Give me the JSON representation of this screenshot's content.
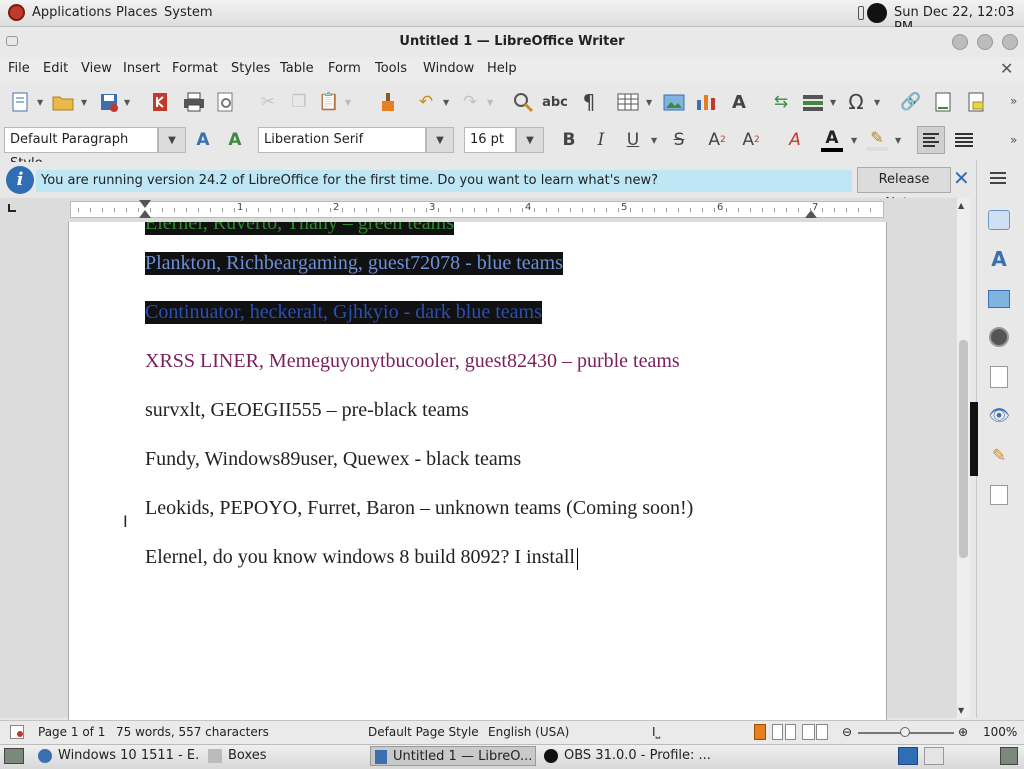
{
  "top_panel": {
    "applications": "Applications",
    "places": "Places",
    "system": "System",
    "clock": "Sun Dec 22, 12:03 PM"
  },
  "window": {
    "title": "Untitled 1 — LibreOffice Writer"
  },
  "menu": {
    "file": "File",
    "edit": "Edit",
    "view": "View",
    "insert": "Insert",
    "format": "Format",
    "styles": "Styles",
    "table": "Table",
    "form": "Form",
    "tools": "Tools",
    "window": "Window",
    "help": "Help"
  },
  "formatting": {
    "paragraph_style": "Default Paragraph Style",
    "font_name": "Liberation Serif",
    "font_size": "16 pt"
  },
  "infobar": {
    "message": "You are running version 24.2 of LibreOffice for the first time. Do you want to learn what's new?",
    "button": "Release Notes"
  },
  "ruler": {
    "numbers": [
      "1",
      "2",
      "3",
      "4",
      "5",
      "6",
      "7"
    ]
  },
  "document": {
    "lines": [
      {
        "text": "Elernel, Ruverto, Thany – green teams",
        "color": "#2e8b2e",
        "highlight": true
      },
      {
        "text": "Plankton, Richbeargaming, guest72078 - blue teams",
        "color": "#6d8fd6",
        "highlight": true
      },
      {
        "text": "Continuator, heckeralt, Gjhkyio - dark blue teams",
        "color": "#2a4fb5",
        "highlight": true
      },
      {
        "text": "XRSS LINER, Memeguyonytbucooler, guest82430 – purble teams",
        "color": "#7a1f5c",
        "highlight": false
      },
      {
        "text": "survxlt, GEOEGII555 – pre-black teams",
        "color": "#222222",
        "highlight": false
      },
      {
        "text": "Fundy, Windows89user, Quewex - black teams",
        "color": "#222222",
        "highlight": false
      },
      {
        "text": "Leokids, PEPOYO, Furret, Baron – unknown teams (Coming soon!)",
        "color": "#222222",
        "highlight": false
      },
      {
        "text": "Elernel, do you know windows 8 build 8092? I install ",
        "color": "#222222",
        "highlight": false
      }
    ]
  },
  "status": {
    "page": "Page 1 of 1",
    "words": "75 words, 557 characters",
    "page_style": "Default Page Style",
    "language": "English (USA)",
    "zoom": "100%"
  },
  "taskbar": {
    "items": [
      "Windows 10 1511 - E...",
      "Boxes",
      "Untitled 1 — LibreO...",
      "OBS 31.0.0 - Profile: ..."
    ]
  },
  "icons": {
    "close": "✕",
    "info": "i"
  }
}
